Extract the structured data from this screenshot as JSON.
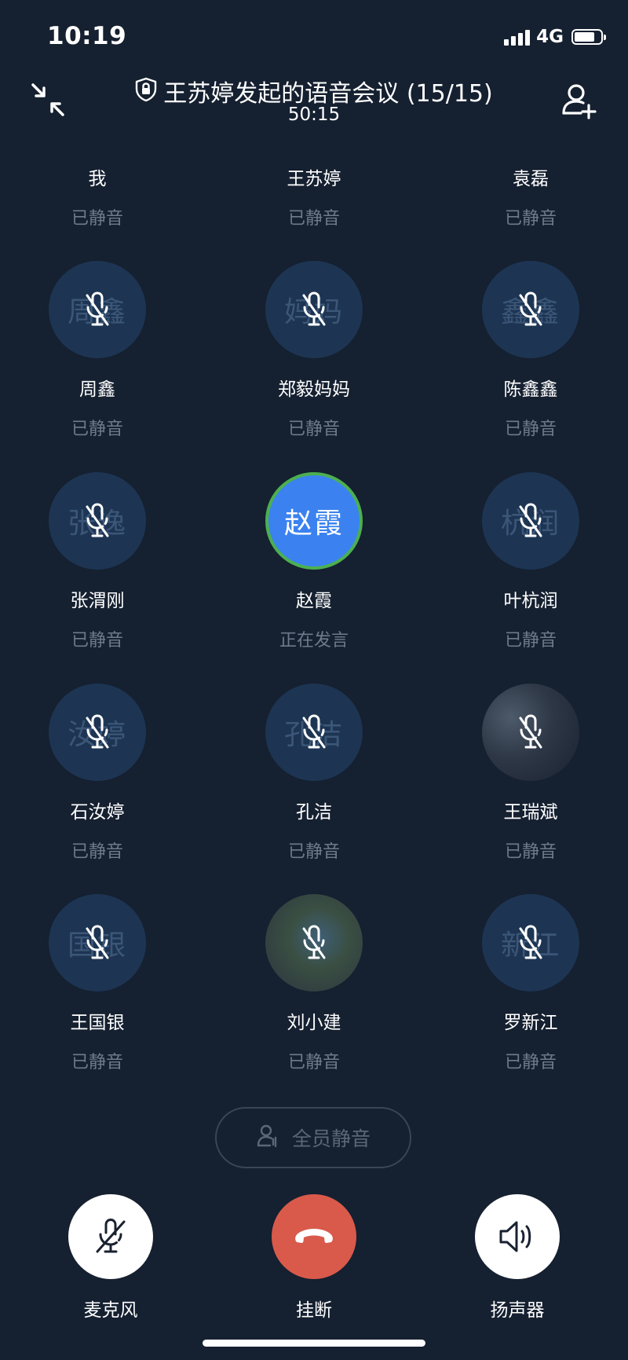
{
  "status_bar": {
    "time": "10:19",
    "network": "4G",
    "battery_level": 0.78
  },
  "header": {
    "title": "王苏婷发起的语音会议 (15/15)",
    "duration": "50:15",
    "minimize_icon": "minimize-arrows-icon",
    "lock_icon": "shield-lock-icon",
    "add_member_icon": "add-person-icon"
  },
  "participants": [
    {
      "name": "我",
      "status": "已静音",
      "avatar_text": ""
    },
    {
      "name": "王苏婷",
      "status": "已静音",
      "avatar_text": ""
    },
    {
      "name": "袁磊",
      "status": "已静音",
      "avatar_text": ""
    },
    {
      "name": "周鑫",
      "status": "已静音",
      "avatar_text": "周鑫"
    },
    {
      "name": "郑毅妈妈",
      "status": "已静音",
      "avatar_text": "妈妈"
    },
    {
      "name": "陈鑫鑫",
      "status": "已静音",
      "avatar_text": "鑫鑫"
    },
    {
      "name": "张渭刚",
      "status": "已静音",
      "avatar_text": "张逸"
    },
    {
      "name": "赵霞",
      "status": "正在发言",
      "avatar_text": "赵霞"
    },
    {
      "name": "叶杭润",
      "status": "已静音",
      "avatar_text": "杭润"
    },
    {
      "name": "石汝婷",
      "status": "已静音",
      "avatar_text": "汝婷"
    },
    {
      "name": "孔洁",
      "status": "已静音",
      "avatar_text": "孔洁"
    },
    {
      "name": "王瑞斌",
      "status": "已静音",
      "avatar_text": ""
    },
    {
      "name": "王国银",
      "status": "已静音",
      "avatar_text": "国银"
    },
    {
      "name": "刘小建",
      "status": "已静音",
      "avatar_text": ""
    },
    {
      "name": "罗新江",
      "status": "已静音",
      "avatar_text": "新江"
    }
  ],
  "mute_all": {
    "label": "全员静音"
  },
  "controls": {
    "mic_label": "麦克风",
    "hangup_label": "挂断",
    "speaker_label": "扬声器"
  },
  "colors": {
    "background": "#152030",
    "avatar_bg": "#1d3553",
    "speaking_blue": "#3b82f0",
    "speaking_ring": "#4caf50",
    "hangup_red": "#d95a4b",
    "muted_text": "#6f7b8c"
  }
}
